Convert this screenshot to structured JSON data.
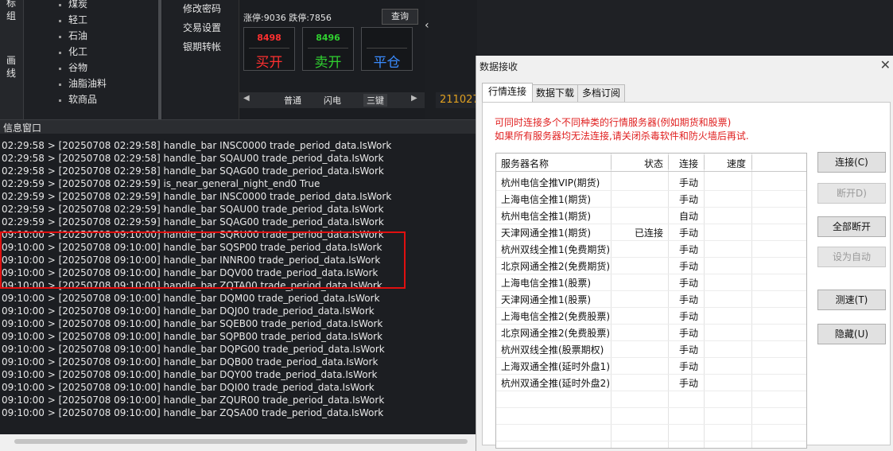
{
  "left_tabs": [
    "标组",
    "画线"
  ],
  "categories": [
    "煤炭",
    "轻工",
    "石油",
    "化工",
    "谷物",
    "油脂油料",
    "软商品"
  ],
  "menu": [
    "修改密码",
    "交易设置",
    "银期转帐"
  ],
  "limits": {
    "up": "涨停:9036",
    "down": "跌停:7856"
  },
  "query_label": "查询",
  "buy": {
    "price": "8498",
    "label": "买开"
  },
  "sell": {
    "price": "8496",
    "label": "卖开"
  },
  "close_pos": {
    "label": "平仓"
  },
  "modes": [
    "普通",
    "闪电",
    "三键"
  ],
  "code_display": "211027",
  "collapse_icon": "‹",
  "info_title": "信息窗口",
  "logs": [
    "02:29:58 > [20250708 02:29:58] handle_bar INSC0000 trade_period_data.IsWork",
    "02:29:58 > [20250708 02:29:58] handle_bar SQAU00 trade_period_data.IsWork",
    "02:29:58 > [20250708 02:29:58] handle_bar SQAG00 trade_period_data.IsWork",
    "02:29:59 > [20250708 02:29:59] is_near_general_night_end0 True",
    "02:29:59 > [20250708 02:29:59] handle_bar INSC0000 trade_period_data.IsWork",
    "02:29:59 > [20250708 02:29:59] handle_bar SQAU00 trade_period_data.IsWork",
    "02:29:59 > [20250708 02:29:59] handle_bar SQAG00 trade_period_data.IsWork",
    "09:10:00 > [20250708 09:10:00] handle_bar SQRU00 trade_period_data.IsWork",
    "09:10:00 > [20250708 09:10:00] handle_bar SQSP00 trade_period_data.IsWork",
    "09:10:00 > [20250708 09:10:00] handle_bar INNR00 trade_period_data.IsWork",
    "09:10:00 > [20250708 09:10:00] handle_bar DQV00 trade_period_data.IsWork",
    "09:10:00 > [20250708 09:10:00] handle_bar ZQTA00 trade_period_data.IsWork",
    "09:10:00 > [20250708 09:10:00] handle_bar DQM00 trade_period_data.IsWork",
    "09:10:00 > [20250708 09:10:00] handle_bar DQJ00 trade_period_data.IsWork",
    "09:10:00 > [20250708 09:10:00] handle_bar SQEB00 trade_period_data.IsWork",
    "09:10:00 > [20250708 09:10:00] handle_bar SQPB00 trade_period_data.IsWork",
    "09:10:00 > [20250708 09:10:00] handle_bar DQPG00 trade_period_data.IsWork",
    "09:10:00 > [20250708 09:10:00] handle_bar DQB00 trade_period_data.IsWork",
    "09:10:00 > [20250708 09:10:00] handle_bar DQY00 trade_period_data.IsWork",
    "09:10:00 > [20250708 09:10:00] handle_bar DQI00 trade_period_data.IsWork",
    "09:10:00 > [20250708 09:10:00] handle_bar ZQUR00 trade_period_data.IsWork",
    "09:10:00 > [20250708 09:10:00] handle_bar ZQSA00 trade_period_data.IsWork"
  ],
  "dialog": {
    "title": "数据接收",
    "close_icon": "✕",
    "tabs": [
      "行情连接",
      "数据下载",
      "多档订阅"
    ],
    "warn1": "可同时连接多个不同种类的行情服务器(例如期货和股票)",
    "warn2": "如果所有服务器均无法连接,请关闭杀毒软件和防火墙后再试.",
    "columns": [
      "服务器名称",
      "状态",
      "连接",
      "速度"
    ],
    "rows": [
      {
        "name": "杭州电信全推VIP(期货)",
        "status": "",
        "conn": "手动"
      },
      {
        "name": "上海电信全推1(期货)",
        "status": "",
        "conn": "手动"
      },
      {
        "name": "杭州电信全推1(期货)",
        "status": "",
        "conn": "自动"
      },
      {
        "name": "天津网通全推1(期货)",
        "status": "已连接",
        "conn": "手动"
      },
      {
        "name": "杭州双线全推1(免费期货)",
        "status": "",
        "conn": "手动"
      },
      {
        "name": "北京网通全推2(免费期货)",
        "status": "",
        "conn": "手动"
      },
      {
        "name": "上海电信全推1(股票)",
        "status": "",
        "conn": "手动"
      },
      {
        "name": "天津网通全推1(股票)",
        "status": "",
        "conn": "手动"
      },
      {
        "name": "上海电信全推2(免费股票)",
        "status": "",
        "conn": "手动"
      },
      {
        "name": "北京网通全推2(免费股票)",
        "status": "",
        "conn": "手动"
      },
      {
        "name": "杭州双线全推(股票期权)",
        "status": "",
        "conn": "手动"
      },
      {
        "name": "上海双通全推(延时外盘1)",
        "status": "",
        "conn": "手动"
      },
      {
        "name": "杭州双通全推(延时外盘2)",
        "status": "",
        "conn": "手动"
      }
    ],
    "buttons": {
      "connect": "连接(C)",
      "disconnect": "断开D)",
      "disconnect_all": "全部断开",
      "set_auto": "设为自动",
      "speed_test": "测速(T)",
      "hide": "隐藏(U)"
    }
  }
}
